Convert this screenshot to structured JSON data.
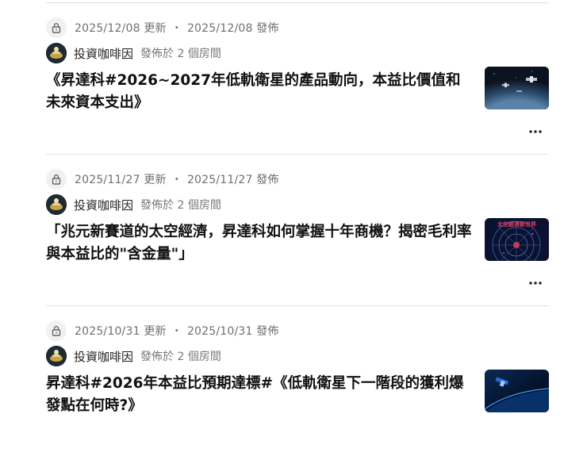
{
  "posts": [
    {
      "updated": "2025/12/08 更新",
      "published": "2025/12/08 發佈",
      "author": "投資咖啡因",
      "room_prefix": "發佈於",
      "room_link": "2 個房間",
      "title": "《昇達科#2026~2027年低軌衛星的產品動向，本益比價值和未來資本支出》"
    },
    {
      "updated": "2025/11/27 更新",
      "published": "2025/11/27 發佈",
      "author": "投資咖啡因",
      "room_prefix": "發佈於",
      "room_link": "2 個房間",
      "title": "「兆元新賽道的太空經濟，昇達科如何掌握十年商機？揭密毛利率與本益比的\"含金量\"」",
      "thumb_caption": "太空經濟新世界"
    },
    {
      "updated": "2025/10/31 更新",
      "published": "2025/10/31 發佈",
      "author": "投資咖啡因",
      "room_prefix": "發佈於",
      "room_link": "2 個房間",
      "title": "昇達科#2026年本益比預期達標#《低軌衛星下一階段的獲利爆發點在何時?》"
    }
  ],
  "ui": {
    "meta_separator": "・",
    "lock_icon": "lock-icon",
    "more_icon": "more-dots-icon"
  },
  "colors": {
    "meta_text": "#6f6f6f",
    "divider": "#e3e3e3",
    "title": "#111111"
  }
}
